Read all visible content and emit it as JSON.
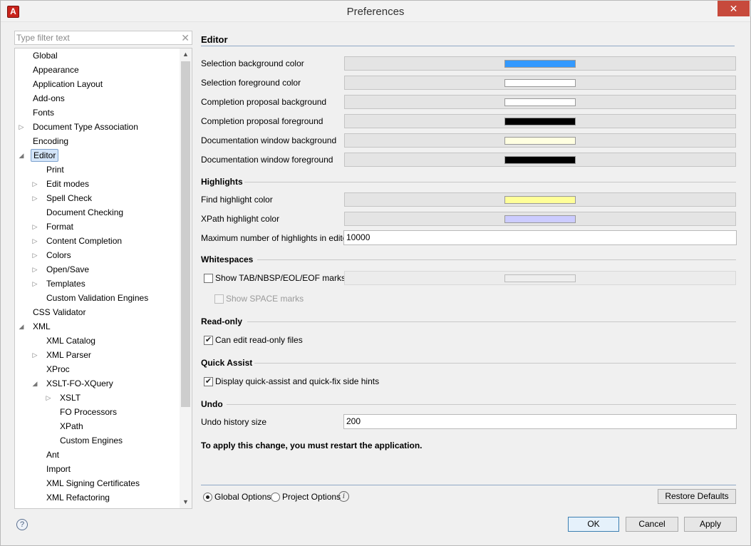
{
  "window": {
    "title": "Preferences",
    "app_icon": "A",
    "close": "✕"
  },
  "filter": {
    "placeholder": "Type filter text",
    "clear": "✕"
  },
  "tree": [
    {
      "label": "Global",
      "level": 0
    },
    {
      "label": "Appearance",
      "level": 0
    },
    {
      "label": "Application Layout",
      "level": 0
    },
    {
      "label": "Add-ons",
      "level": 0
    },
    {
      "label": "Fonts",
      "level": 0
    },
    {
      "label": "Document Type Association",
      "level": 0,
      "expander": "collapsed"
    },
    {
      "label": "Encoding",
      "level": 0
    },
    {
      "label": "Editor",
      "level": 0,
      "expander": "expanded",
      "selected": true
    },
    {
      "label": "Print",
      "level": 1
    },
    {
      "label": "Edit modes",
      "level": 1,
      "expander": "collapsed"
    },
    {
      "label": "Spell Check",
      "level": 1,
      "expander": "collapsed"
    },
    {
      "label": "Document Checking",
      "level": 1
    },
    {
      "label": "Format",
      "level": 1,
      "expander": "collapsed"
    },
    {
      "label": "Content Completion",
      "level": 1,
      "expander": "collapsed"
    },
    {
      "label": "Colors",
      "level": 1,
      "expander": "collapsed"
    },
    {
      "label": "Open/Save",
      "level": 1,
      "expander": "collapsed"
    },
    {
      "label": "Templates",
      "level": 1,
      "expander": "collapsed"
    },
    {
      "label": "Custom Validation Engines",
      "level": 1
    },
    {
      "label": "CSS Validator",
      "level": 0
    },
    {
      "label": "XML",
      "level": 0,
      "expander": "expanded"
    },
    {
      "label": "XML Catalog",
      "level": 1
    },
    {
      "label": "XML Parser",
      "level": 1,
      "expander": "collapsed"
    },
    {
      "label": "XProc",
      "level": 1
    },
    {
      "label": "XSLT-FO-XQuery",
      "level": 1,
      "expander": "expanded"
    },
    {
      "label": "XSLT",
      "level": 2,
      "expander": "collapsed"
    },
    {
      "label": "FO Processors",
      "level": 2
    },
    {
      "label": "XPath",
      "level": 2
    },
    {
      "label": "Custom Engines",
      "level": 2
    },
    {
      "label": "Ant",
      "level": 1
    },
    {
      "label": "Import",
      "level": 1
    },
    {
      "label": "XML Signing Certificates",
      "level": 1
    },
    {
      "label": "XML Refactoring",
      "level": 1
    }
  ],
  "icons": {
    "expanded": "◢",
    "collapsed": "▷",
    "scroll_up": "▲",
    "scroll_down": "▼",
    "check": "✔",
    "info": "i",
    "help": "?"
  },
  "editor": {
    "title": "Editor",
    "colors": [
      {
        "label": "Selection background color",
        "swatch": "#3399ff"
      },
      {
        "label": "Selection foreground color",
        "swatch": "#ffffff"
      },
      {
        "label": "Completion proposal background",
        "swatch": "#ffffff"
      },
      {
        "label": "Completion proposal foreground",
        "swatch": "#000000"
      },
      {
        "label": "Documentation window background",
        "swatch": "#ffffe1"
      },
      {
        "label": "Documentation window foreground",
        "swatch": "#000000"
      }
    ]
  },
  "highlights": {
    "title": "Highlights",
    "find_label": "Find highlight color",
    "find_swatch": "#ffff99",
    "xpath_label": "XPath highlight color",
    "xpath_swatch": "#ccccff",
    "max_label": "Maximum number of highlights in editor",
    "max_value": "10000"
  },
  "whitespaces": {
    "title": "Whitespaces",
    "show_marks_label": "Show TAB/NBSP/EOL/EOF marks",
    "show_marks_checked": false,
    "marks_swatch": "#eeeeee",
    "show_space_label": "Show SPACE marks",
    "show_space_checked": false
  },
  "readonly": {
    "title": "Read-only",
    "can_edit_label": "Can edit read-only files",
    "can_edit_checked": true
  },
  "quick_assist": {
    "title": "Quick Assist",
    "display_label": "Display quick-assist and quick-fix side hints",
    "display_checked": true
  },
  "undo": {
    "title": "Undo",
    "history_label": "Undo history size",
    "history_value": "200"
  },
  "restart_notice": "To apply this change, you must restart the application.",
  "options": {
    "global_label": "Global Options",
    "global_selected": true,
    "project_label": "Project Options",
    "project_selected": false,
    "restore_label": "Restore Defaults"
  },
  "footer": {
    "ok_label": "OK",
    "cancel_label": "Cancel",
    "apply_label": "Apply"
  },
  "colors": {
    "accent_selection": "#d4e5f9",
    "close_button": "#c74a3c"
  }
}
